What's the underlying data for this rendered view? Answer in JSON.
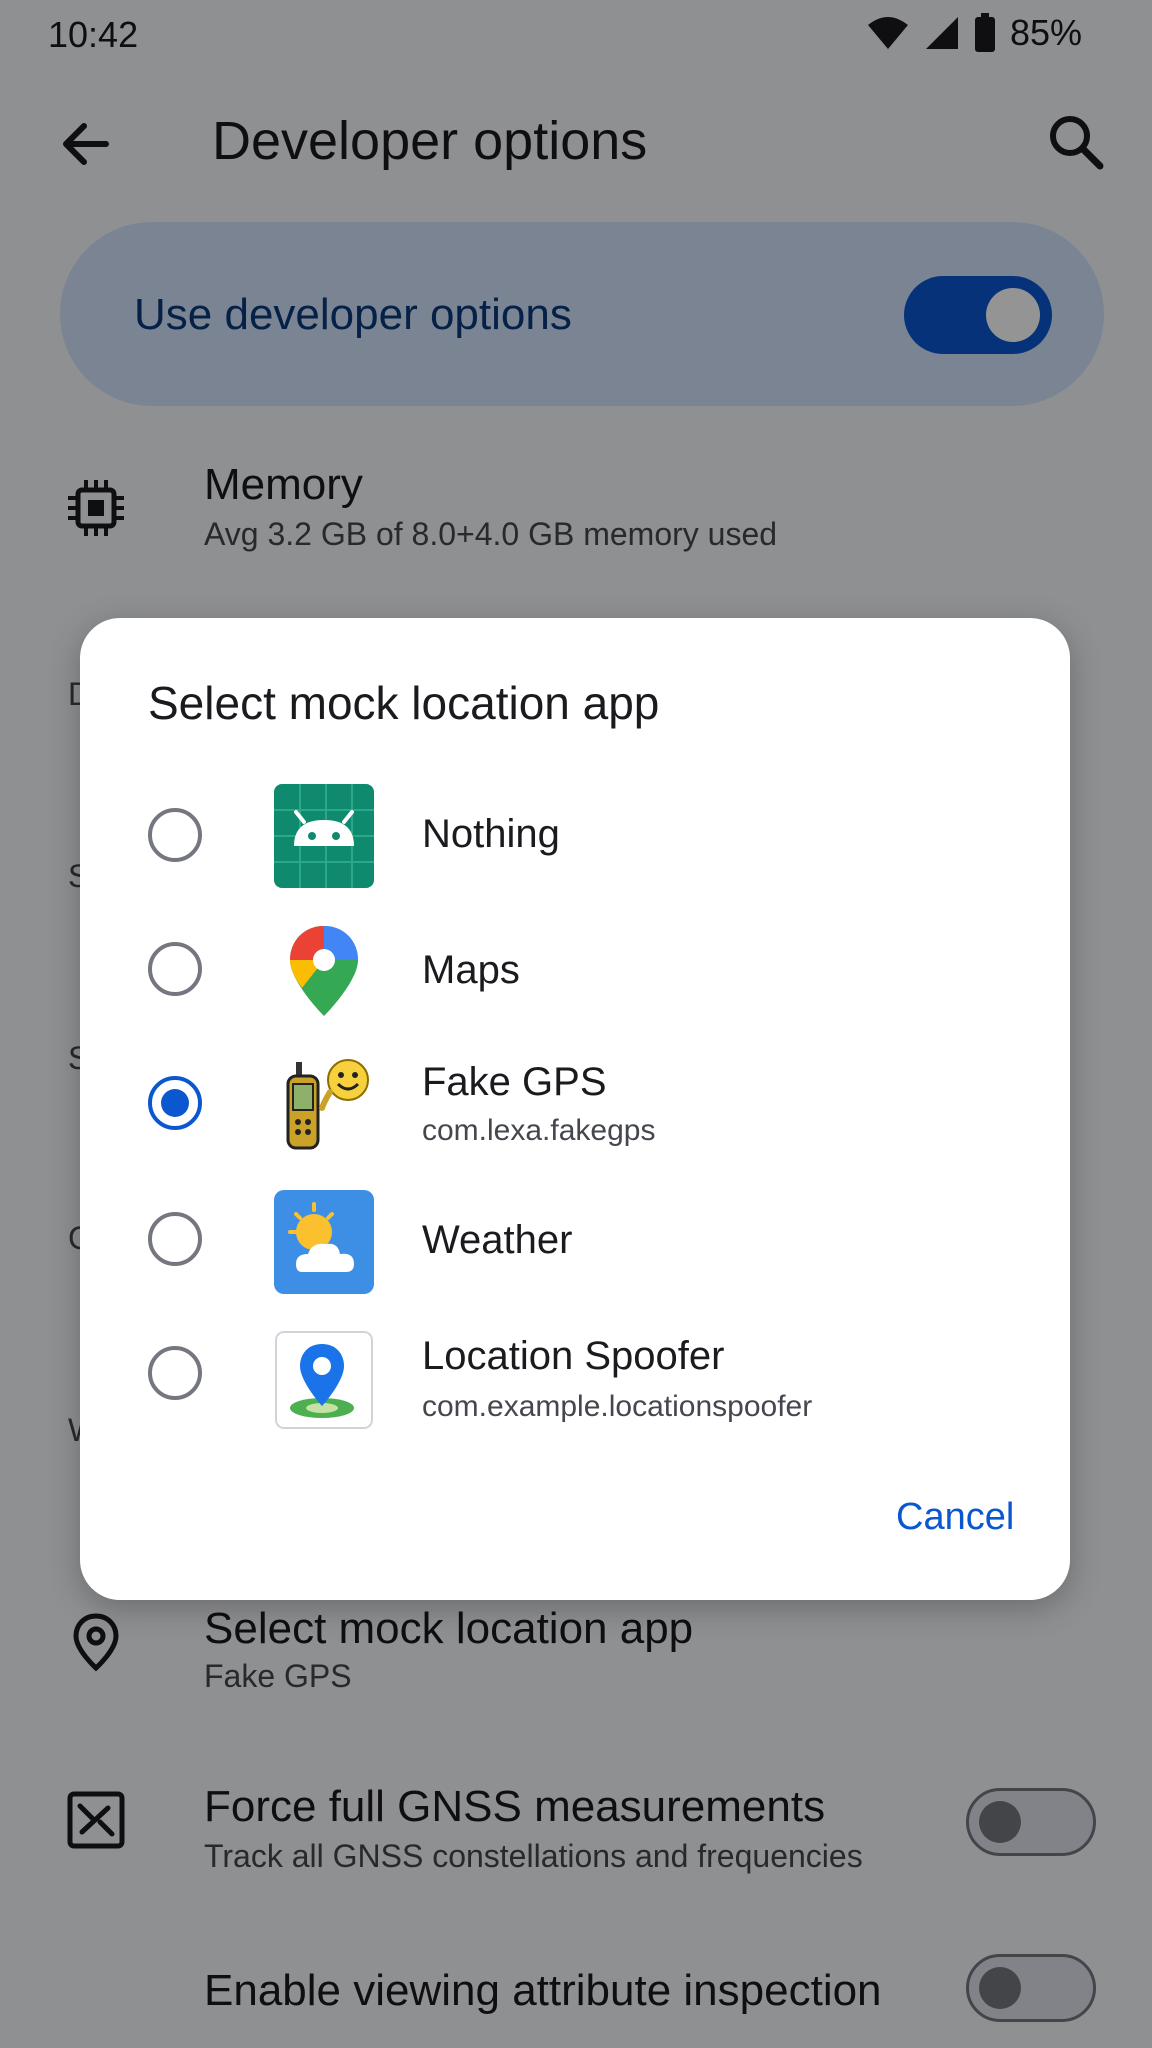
{
  "status_bar": {
    "time": "10:42",
    "battery": "85%"
  },
  "app_bar": {
    "title": "Developer options"
  },
  "main_toggle": {
    "label": "Use developer options",
    "on": true
  },
  "settings": {
    "memory": {
      "title": "Memory",
      "subtitle": "Avg 3.2 GB of 8.0+4.0 GB memory used"
    },
    "hidden_row_initials": [
      "D",
      "S",
      "S",
      "C",
      "W"
    ],
    "mock_location": {
      "title": "Select mock location app",
      "subtitle": "Fake GPS"
    },
    "gnss": {
      "title": "Force full GNSS measurements",
      "subtitle": "Track all GNSS constellations and frequencies",
      "on": false
    },
    "attribute_inspection": {
      "title": "Enable viewing attribute inspection",
      "on": false
    }
  },
  "dialog": {
    "title": "Select mock location app",
    "options": [
      {
        "label": "Nothing",
        "package": "",
        "icon": "android-icon",
        "selected": false
      },
      {
        "label": "Maps",
        "package": "",
        "icon": "maps-pin-icon",
        "selected": false
      },
      {
        "label": "Fake GPS",
        "package": "com.lexa.fakegps",
        "icon": "fake-gps-icon",
        "selected": true
      },
      {
        "label": "Weather",
        "package": "",
        "icon": "weather-icon",
        "selected": false
      },
      {
        "label": "Location Spoofer",
        "package": "com.example.locationspoofer",
        "icon": "location-spoofer-icon",
        "selected": false
      }
    ],
    "cancel_label": "Cancel"
  },
  "colors": {
    "accent": "#0b57d0",
    "card": "#d3e3fd",
    "scrim": "rgba(0,0,0,0.42)"
  }
}
